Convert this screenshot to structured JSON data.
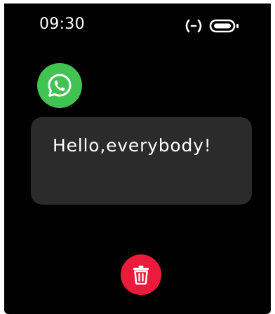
{
  "status_bar": {
    "time": "09:30",
    "icons": [
      "connection-icon",
      "battery-icon"
    ]
  },
  "notification": {
    "app_icon": "whatsapp-icon",
    "message": "Hello,everybody!"
  },
  "actions": {
    "delete_icon": "trash-icon"
  },
  "colors": {
    "background": "#000000",
    "card": "#2b2b2b",
    "app_icon": "#40c351",
    "delete": "#ec1b3c",
    "text": "#ffffff"
  }
}
